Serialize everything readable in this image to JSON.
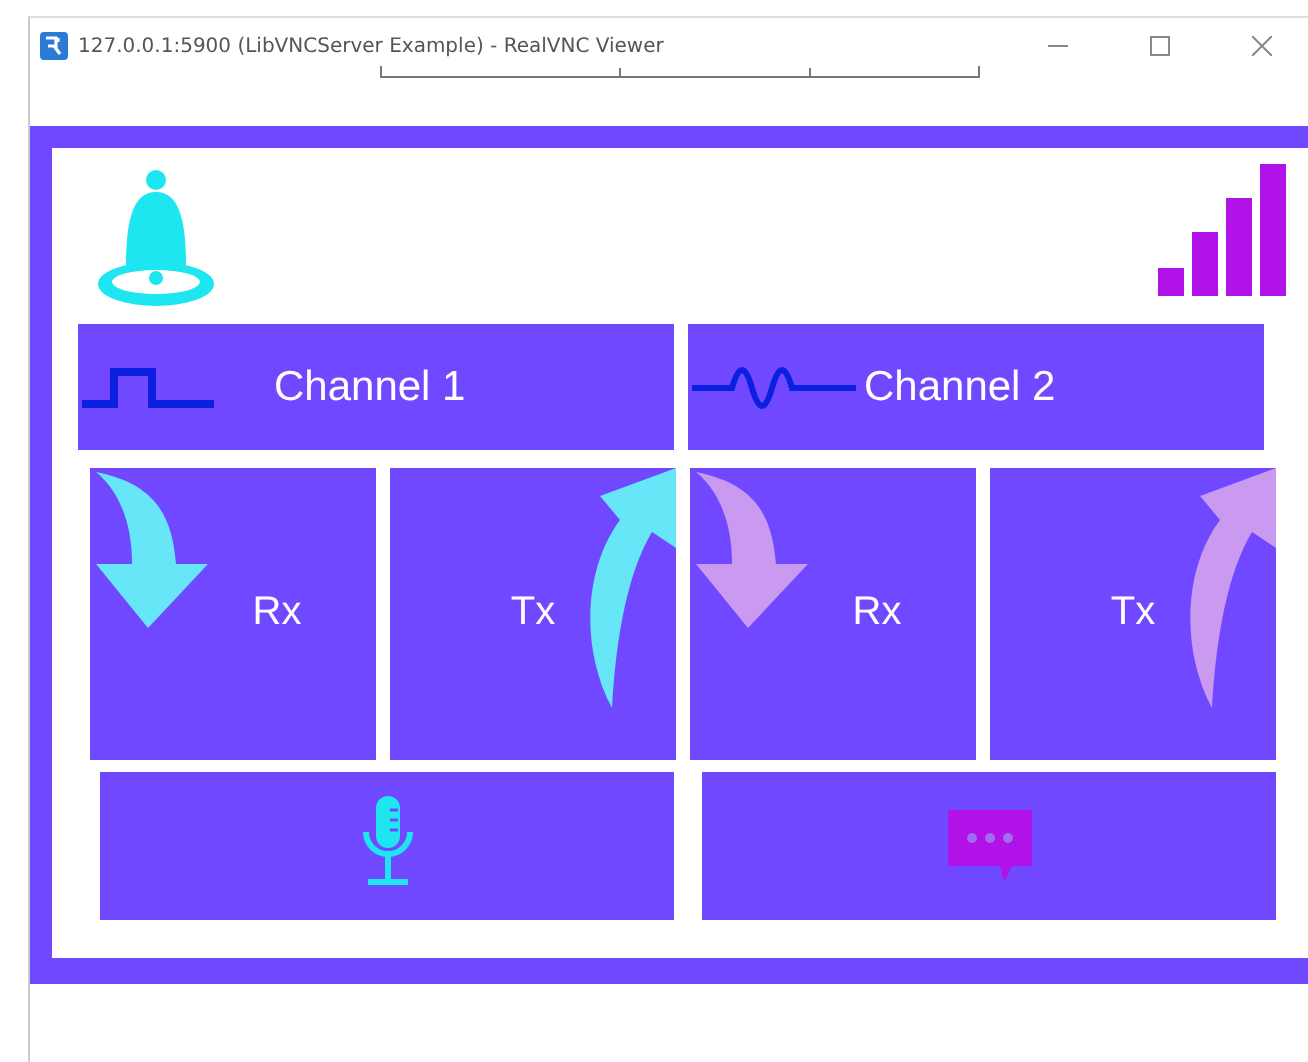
{
  "window": {
    "title": "127.0.0.1:5900 (LibVNCServer Example) - RealVNC Viewer"
  },
  "channels": [
    {
      "label": "Channel 1",
      "kind": "square",
      "color": "#66e6f7",
      "tiles": [
        {
          "kind": "rx",
          "label": "Rx"
        },
        {
          "kind": "tx",
          "label": "Tx"
        }
      ]
    },
    {
      "label": "Channel 2",
      "kind": "sine",
      "color": "#c99af0",
      "tiles": [
        {
          "kind": "rx",
          "label": "Rx"
        },
        {
          "kind": "tx",
          "label": "Tx"
        }
      ]
    }
  ],
  "actions": [
    {
      "kind": "microphone"
    },
    {
      "kind": "chat"
    }
  ]
}
